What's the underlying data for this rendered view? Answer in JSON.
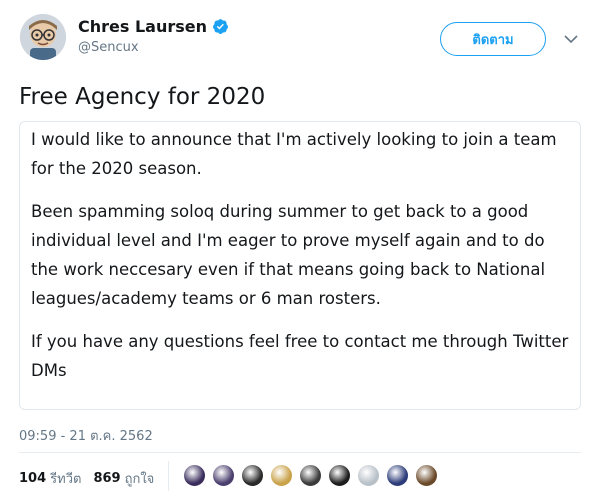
{
  "author": {
    "display_name": "Chres Laursen",
    "handle": "@Sencux",
    "verified": true,
    "avatar_icon": "cartoon-avatar-icon"
  },
  "actions": {
    "follow_label": "ติดตาม",
    "more_icon": "chevron-down-icon"
  },
  "tweet": {
    "title": "Free Agency for 2020",
    "paragraphs": [
      "I would like to announce that I'm actively looking to join a team for the 2020 season.",
      "Been spamming soloq during summer to get back to a good individual level and I'm eager to prove myself again and to do the work neccesary even if that means going back to National leagues/academy  teams or 6 man rosters.",
      "If you have any questions feel free to contact me through Twitter DMs"
    ],
    "timestamp": "09:59 - 21 ต.ค. 2562"
  },
  "stats": {
    "retweets_count": "104",
    "retweets_label": "รีทวีต",
    "likes_count": "869",
    "likes_label": "ถูกใจ"
  },
  "likers": [
    {
      "color": "#3a2d5c"
    },
    {
      "color": "#4b3f6e"
    },
    {
      "color": "#2a2a2a"
    },
    {
      "color": "#c9a24a"
    },
    {
      "color": "#3b3b3b"
    },
    {
      "color": "#1d1d1d"
    },
    {
      "color": "#b8c0c8"
    },
    {
      "color": "#2d3c7a"
    },
    {
      "color": "#6b4a2a"
    }
  ],
  "colors": {
    "accent": "#1da1f2",
    "text": "#14171a",
    "secondary": "#657786"
  }
}
